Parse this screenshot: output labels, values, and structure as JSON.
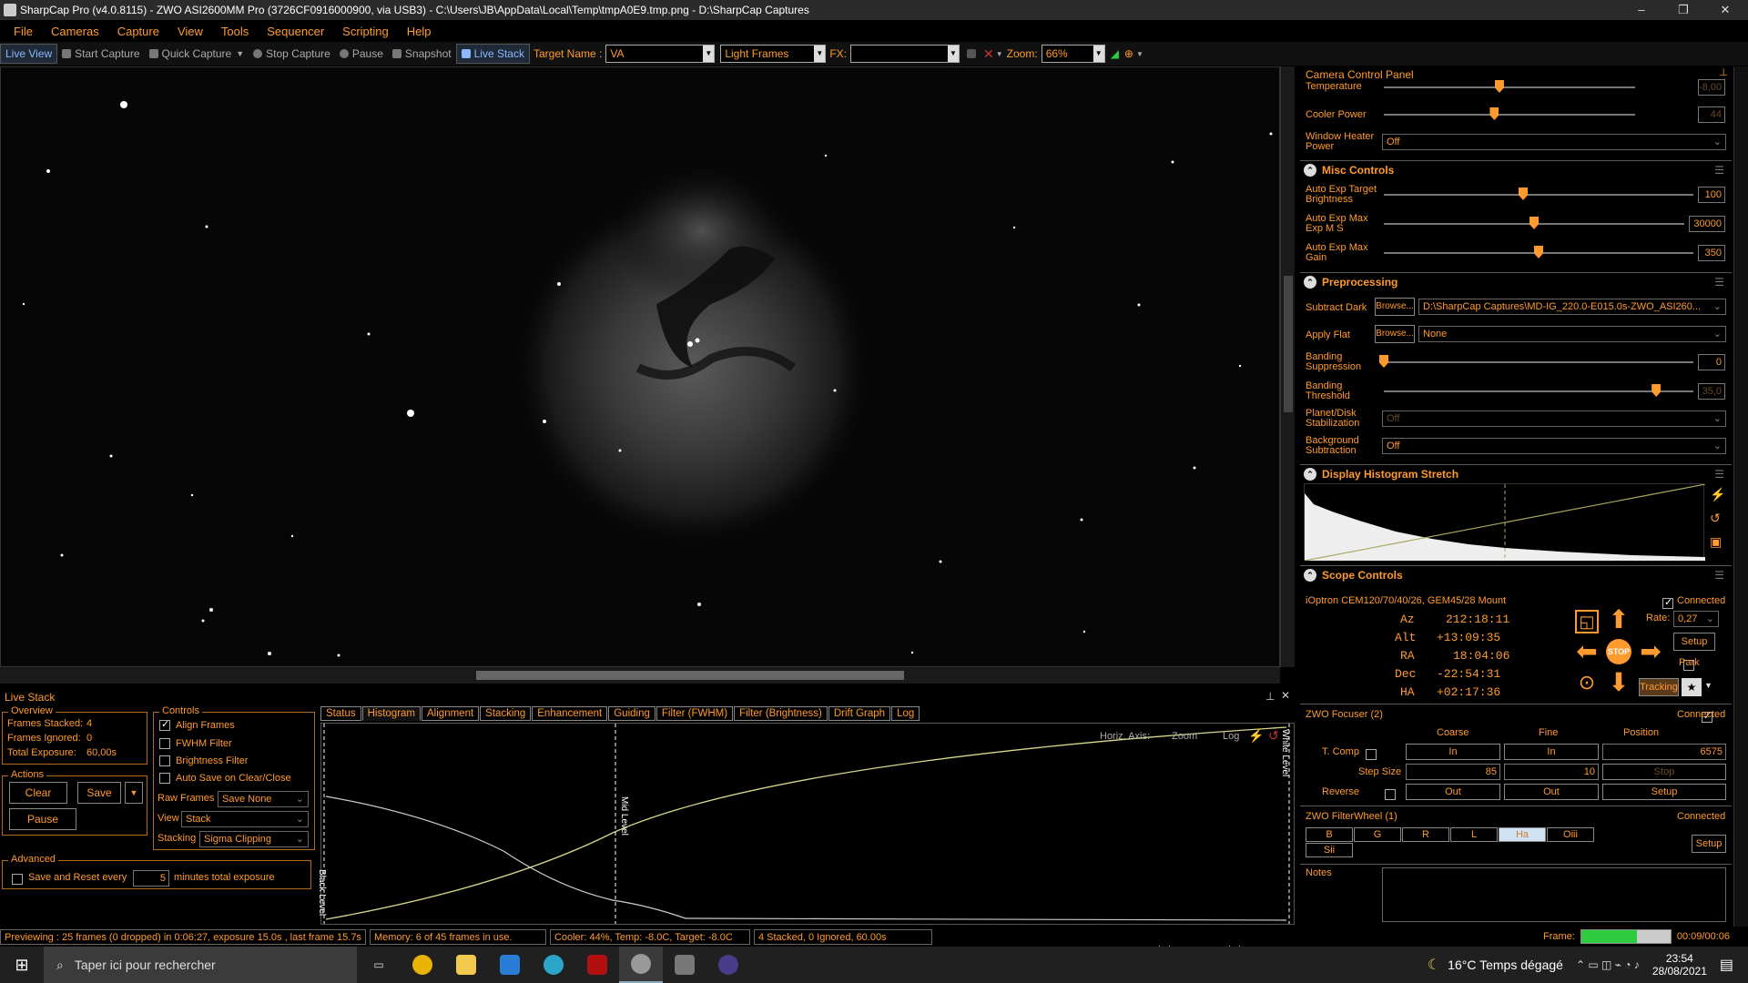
{
  "window": {
    "title": "SharpCap Pro (v4.0.8115) - ZWO ASI2600MM Pro (3726CF0916000900, via USB3) - C:\\Users\\JB\\AppData\\Local\\Temp\\tmpA0E9.tmp.png - D:\\SharpCap Captures",
    "min": "–",
    "max": "❐",
    "close": "✕"
  },
  "menu": [
    "File",
    "Cameras",
    "Capture",
    "View",
    "Tools",
    "Sequencer",
    "Scripting",
    "Help"
  ],
  "toolbar": {
    "live_view": "Live View",
    "start_capture": "Start Capture",
    "quick_capture": "Quick Capture",
    "stop_capture": "Stop Capture",
    "pause": "Pause",
    "snapshot": "Snapshot",
    "live_stack": "Live Stack",
    "target_label": "Target Name :",
    "target_value": "VA",
    "frame_type": "Light Frames",
    "fx_label": "FX:",
    "fx_value": "",
    "zoom_label": "Zoom:",
    "zoom_value": "66%"
  },
  "live_stack": {
    "title": "Live Stack",
    "overview": {
      "title": "Overview",
      "stacked_label": "Frames Stacked:",
      "stacked": "4",
      "ignored_label": "Frames Ignored:",
      "ignored": "0",
      "exposure_label": "Total Exposure:",
      "exposure": "60,00s"
    },
    "actions": {
      "title": "Actions",
      "clear": "Clear",
      "save": "Save",
      "pause": "Pause"
    },
    "controls": {
      "title": "Controls",
      "align": "Align Frames",
      "fwhm": "FWHM Filter",
      "brightness": "Brightness Filter",
      "autosave": "Auto Save on Clear/Close",
      "raw_label": "Raw Frames",
      "raw_value": "Save None",
      "view_label": "View",
      "view_value": "Stack",
      "stacking_label": "Stacking",
      "stacking_value": "Sigma Clipping"
    },
    "advanced": {
      "title": "Advanced",
      "reset_label": "Save and Reset every",
      "reset_value": "5",
      "reset_suffix": "minutes total exposure"
    },
    "tabs": [
      "Status",
      "Histogram",
      "Alignment",
      "Stacking",
      "Enhancement",
      "Guiding",
      "Filter (FWHM)",
      "Filter (Brightness)",
      "Drift Graph",
      "Log"
    ],
    "active_tab": "Histogram",
    "hist": {
      "horiz_axis": "Horiz. Axis:",
      "zoom": "Zoom",
      "log": "Log",
      "black": "Black Level",
      "mid": "Mid Level",
      "white": "White Level"
    }
  },
  "camera_panel": {
    "title": "Camera Control Panel",
    "temperature_label": "Temperature",
    "temperature": "-8,00",
    "temperature_level": 0.46,
    "cooler_label": "Cooler Power",
    "cooler": "44",
    "cooler_level": 0.44,
    "heater_label": "Window Heater Power",
    "heater": "Off",
    "misc": {
      "title": "Misc Controls",
      "target_label": "Auto Exp Target Brightness",
      "target": "100",
      "target_level": 0.45,
      "maxexp_label": "Auto Exp Max Exp M S",
      "maxexp": "30000",
      "maxexp_level": 0.5,
      "maxgain_label": "Auto Exp Max Gain",
      "maxgain": "350",
      "maxgain_level": 0.5
    },
    "pre": {
      "title": "Preprocessing",
      "dark_label": "Subtract Dark",
      "browse": "Browse...",
      "dark": "D:\\SharpCap Captures\\MD-IG_220.0-E015.0s-ZWO_ASI260...",
      "flat_label": "Apply Flat",
      "flat": "None",
      "band_label": "Banding Suppression",
      "band": "0",
      "band_level": 0.0,
      "thresh_label": "Banding Threshold",
      "thresh": "35,0",
      "thresh_level": 0.88,
      "planet_label": "Planet/Disk Stabilization",
      "planet": "Off",
      "bg_label": "Background Subtraction",
      "bg": "Off"
    },
    "stretch_title": "Display Histogram Stretch",
    "scope": {
      "title": "Scope Controls",
      "mount": "iOptron CEM120/70/40/26, GEM45/28 Mount",
      "connected": "Connected",
      "az_label": "Az",
      "az": "212:18:11",
      "alt_label": "Alt",
      "alt": "+13:09:35",
      "ra_label": "RA",
      "ra": "18:04:06",
      "dec_label": "Dec",
      "dec": "-22:54:31",
      "ha_label": "HA",
      "ha": "+02:17:36",
      "stop": "STOP",
      "rate_label": "Rate:",
      "rate": "0,27",
      "setup": "Setup",
      "park": "Park",
      "tracking": "Tracking"
    },
    "focuser": {
      "title": "ZWO Focuser (2)",
      "connected": "Connected",
      "coarse": "Coarse",
      "fine": "Fine",
      "position": "Position",
      "tcomp": "T. Comp",
      "in": "In",
      "pos_value": "6575",
      "step_label": "Step Size",
      "step_coarse": "85",
      "step_fine": "10",
      "stop": "Stop",
      "reverse": "Reverse",
      "out": "Out",
      "setup": "Setup"
    },
    "filterwheel": {
      "title": "ZWO FilterWheel (1)",
      "connected": "Connected",
      "filters": [
        "B",
        "G",
        "R",
        "L",
        "Ha",
        "Oiii",
        "Sii"
      ],
      "active": "Ha",
      "setup": "Setup"
    },
    "notes_label": "Notes"
  },
  "status": {
    "preview": "Previewing : 25 frames (0 dropped) in 0:06:27, exposure 15.0s , last frame 15.7s",
    "memory": "Memory: 6 of 45 frames in use.",
    "cooler": "Cooler: 44%, Temp: -8.0C, Target: -8.0C",
    "stacked": "4 Stacked, 0 Ignored, 60.00s",
    "frame_label": "Frame:",
    "frame_progress": 0.62,
    "frame_time": "00:09/00:06"
  },
  "taskbar": {
    "search": "Taper ici pour rechercher",
    "weather": "16°C  Temps dégagé",
    "time": "23:54",
    "date": "28/08/2021"
  },
  "colors": {
    "accent": "#ff9a2e",
    "frame_bar": "#2ecc40"
  }
}
